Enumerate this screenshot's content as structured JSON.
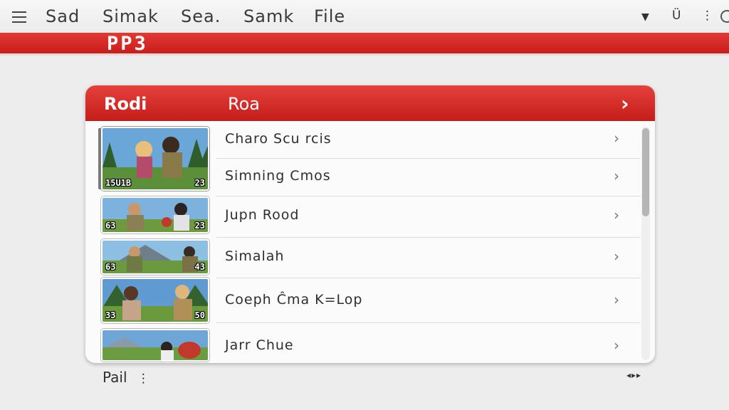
{
  "menu": {
    "items": [
      "Sad",
      "Simak",
      "Sea.",
      "Samk",
      "File"
    ],
    "icons": [
      "hamburger-icon",
      "dropdown-arrow-icon",
      "u-icon",
      "more-vertical-icon",
      "circle-icon"
    ],
    "u_glyph": "Ü",
    "more_glyph": "⋮"
  },
  "brand": {
    "text": "PP3",
    "color": "#d42a26"
  },
  "panel": {
    "header_left": "Rodi",
    "header_mid": "Roa",
    "header_chevron": "›",
    "rows": [
      {
        "label": "Charo Scu rcis",
        "chevron": "›"
      },
      {
        "label": "Simning Cmos",
        "chevron": "›"
      },
      {
        "label": "Jupn Rood",
        "chevron": "›"
      },
      {
        "label": "Simalah",
        "chevron": "›"
      },
      {
        "label": "Coeph Ĉma K=Lop",
        "chevron": "›"
      },
      {
        "label": "Jarr Chue",
        "chevron": "›"
      }
    ],
    "thumbnails": [
      {
        "left": "15U1B",
        "right": "23",
        "icon": "game-scene-thumbnail"
      },
      {
        "left": "63",
        "right": "23",
        "icon": "game-scene-thumbnail"
      },
      {
        "left": "63",
        "right": "43",
        "icon": "game-scene-thumbnail"
      },
      {
        "left": "33",
        "right": "50",
        "icon": "game-scene-thumbnail"
      },
      {
        "left": "",
        "right": "",
        "icon": "game-scene-thumbnail"
      }
    ]
  },
  "footer": {
    "label": "Pail",
    "separator": "⋮",
    "nav": "◂▸▸"
  }
}
